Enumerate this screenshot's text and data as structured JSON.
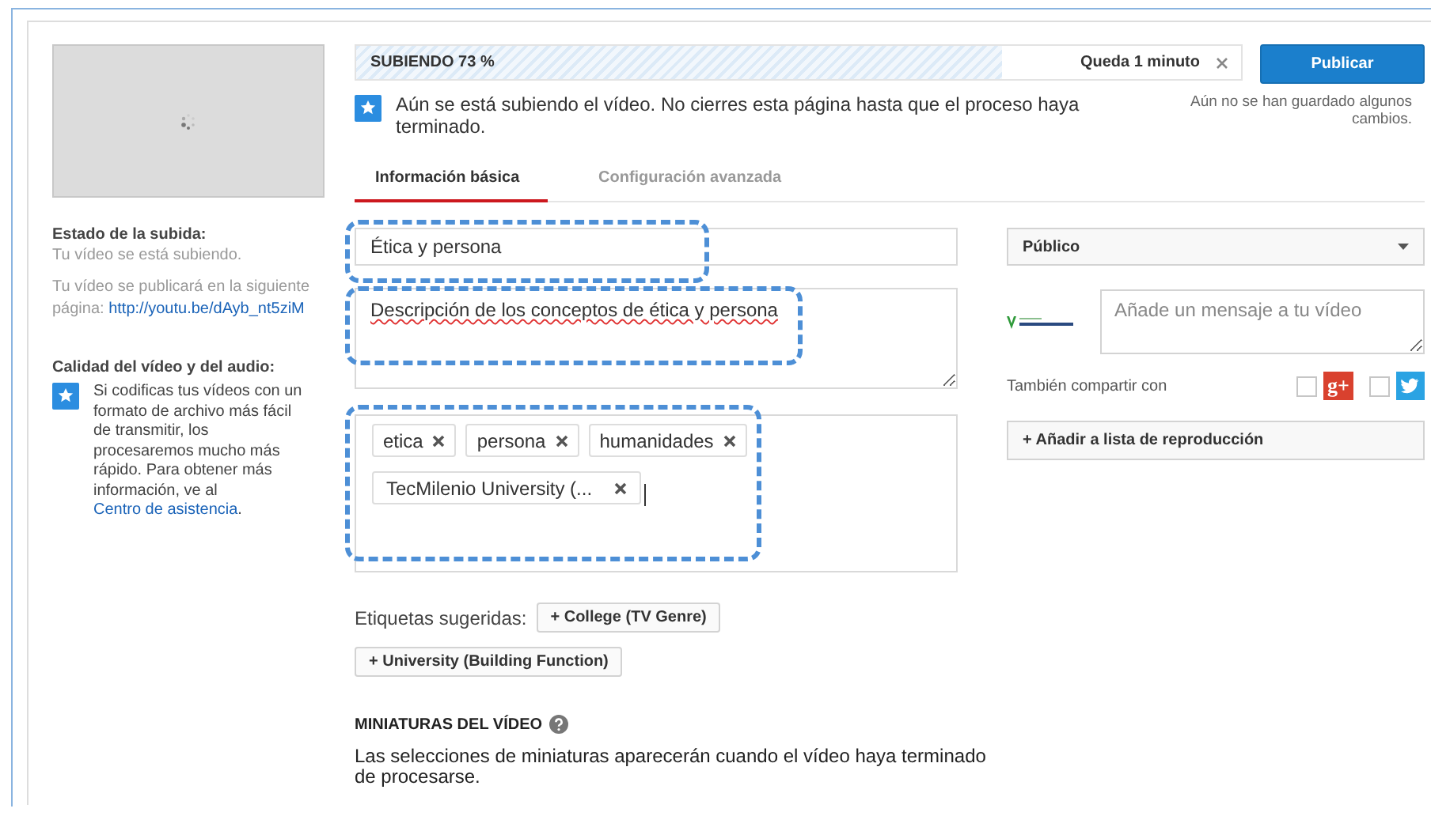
{
  "sidebar": {
    "status_heading": "Estado de la subida:",
    "status_text": "Tu vídeo se está subiendo.",
    "publish_note": "Tu vídeo se publicará en la siguiente página:",
    "publish_link": "http://youtu.be/dAyb_nt5ziM",
    "quality_heading": "Calidad del vídeo y del audio:",
    "quality_tip": "Si codificas tus vídeos con un formato de archivo más fácil de transmitir, los procesaremos mucho más rápido. Para obtener más información, ve al",
    "help_link": "Centro de asistencia",
    "tip_end": "."
  },
  "upload": {
    "status": "SUBIENDO 73 %",
    "level": 0.73,
    "remaining": "Queda 1 minuto"
  },
  "publish_button": "Publicar",
  "notice": "Aún se está subiendo el vídeo. No cierres esta página hasta que el proceso haya terminado.",
  "unsaved": "Aún no se han guardado algunos cambios.",
  "tabs": [
    {
      "label": "Información básica",
      "selected": true
    },
    {
      "label": "Configuración avanzada",
      "selected": false
    }
  ],
  "form": {
    "title": {
      "value": "Ética y persona",
      "highlighted": true
    },
    "description": {
      "value": "Descripción de los conceptos de ética y persona",
      "highlighted": true
    },
    "tags": {
      "highlighted": true,
      "items": [
        "etica",
        "persona",
        "humanidades",
        "TecMilenio University (..."
      ]
    },
    "suggested_label": "Etiquetas sugeridas:",
    "suggested": [
      "+ College (TV Genre)",
      "+ University (Building Function)"
    ],
    "thumbnails_heading": "MINIATURAS DEL VÍDEO",
    "thumbnails_note": "Las selecciones de miniaturas aparecerán cuando el vídeo haya terminado de procesarse."
  },
  "side": {
    "privacy": "Público",
    "message": {
      "placeholder": "Añade un mensaje a tu vídeo"
    },
    "share_label": "También compartir con",
    "share": [
      {
        "kind": "googleplus",
        "icon": "g+",
        "checked": false
      },
      {
        "kind": "twitter",
        "checked": false
      }
    ],
    "playlist_button": "+ Añadir a lista de reproducción"
  }
}
